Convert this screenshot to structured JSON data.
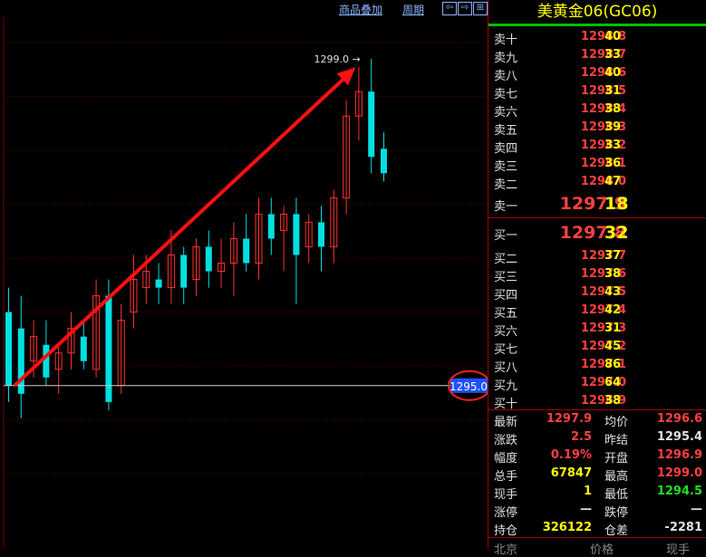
{
  "toolbar": {
    "overlay_label": "商品叠加",
    "period_label": "周期",
    "btn_prev": "⇦",
    "btn_next": "⇨",
    "btn_zoom": "⊞"
  },
  "chart_data": {
    "type": "candlestick",
    "high_annotation": "1299.0",
    "current_price_tag": "1295.0",
    "ylim": [
      1293.8,
      1299.4
    ],
    "up_color": "#ff3030",
    "down_color": "#00e0e0",
    "candles": [
      {
        "o": 1295.9,
        "h": 1296.2,
        "c": 1295.0,
        "l": 1294.8
      },
      {
        "o": 1295.7,
        "h": 1296.1,
        "c": 1294.9,
        "l": 1294.6
      },
      {
        "o": 1295.3,
        "h": 1295.8,
        "c": 1295.6,
        "l": 1295.1
      },
      {
        "o": 1295.5,
        "h": 1295.8,
        "c": 1295.1,
        "l": 1295.0
      },
      {
        "o": 1295.2,
        "h": 1295.5,
        "c": 1295.4,
        "l": 1294.9
      },
      {
        "o": 1295.4,
        "h": 1295.9,
        "c": 1295.7,
        "l": 1295.2
      },
      {
        "o": 1295.6,
        "h": 1295.8,
        "c": 1295.3,
        "l": 1295.2
      },
      {
        "o": 1295.2,
        "h": 1296.3,
        "c": 1296.1,
        "l": 1295.1
      },
      {
        "o": 1296.1,
        "h": 1296.3,
        "c": 1294.8,
        "l": 1294.7
      },
      {
        "o": 1295.0,
        "h": 1296.0,
        "c": 1295.8,
        "l": 1294.9
      },
      {
        "o": 1295.9,
        "h": 1296.6,
        "c": 1296.3,
        "l": 1295.7
      },
      {
        "o": 1296.2,
        "h": 1296.6,
        "c": 1296.4,
        "l": 1296.0
      },
      {
        "o": 1296.3,
        "h": 1296.5,
        "c": 1296.2,
        "l": 1296.0
      },
      {
        "o": 1296.2,
        "h": 1296.9,
        "c": 1296.6,
        "l": 1296.0
      },
      {
        "o": 1296.6,
        "h": 1296.7,
        "c": 1296.2,
        "l": 1296.0
      },
      {
        "o": 1296.3,
        "h": 1296.8,
        "c": 1296.7,
        "l": 1296.1
      },
      {
        "o": 1296.7,
        "h": 1296.9,
        "c": 1296.4,
        "l": 1296.2
      },
      {
        "o": 1296.4,
        "h": 1296.8,
        "c": 1296.5,
        "l": 1296.2
      },
      {
        "o": 1296.5,
        "h": 1297.0,
        "c": 1296.8,
        "l": 1296.1
      },
      {
        "o": 1296.8,
        "h": 1297.1,
        "c": 1296.5,
        "l": 1296.4
      },
      {
        "o": 1296.5,
        "h": 1297.3,
        "c": 1297.1,
        "l": 1296.3
      },
      {
        "o": 1297.1,
        "h": 1297.3,
        "c": 1296.8,
        "l": 1296.6
      },
      {
        "o": 1296.9,
        "h": 1297.2,
        "c": 1297.1,
        "l": 1296.4
      },
      {
        "o": 1297.1,
        "h": 1297.3,
        "c": 1296.6,
        "l": 1296.0
      },
      {
        "o": 1296.7,
        "h": 1297.1,
        "c": 1297.0,
        "l": 1296.5
      },
      {
        "o": 1297.0,
        "h": 1297.2,
        "c": 1296.7,
        "l": 1296.4
      },
      {
        "o": 1296.7,
        "h": 1297.4,
        "c": 1297.3,
        "l": 1296.5
      },
      {
        "o": 1297.3,
        "h": 1298.5,
        "c": 1298.3,
        "l": 1297.1
      },
      {
        "o": 1298.3,
        "h": 1298.9,
        "c": 1298.6,
        "l": 1298.0
      },
      {
        "o": 1298.6,
        "h": 1299.0,
        "c": 1297.8,
        "l": 1297.6
      },
      {
        "o": 1297.9,
        "h": 1298.1,
        "c": 1297.6,
        "l": 1297.5
      }
    ],
    "trend_arrow": {
      "from": [
        0,
        1295.0
      ],
      "to": [
        28,
        1298.9
      ]
    }
  },
  "quote": {
    "title": "美黄金06(GC06)",
    "asks": [
      {
        "label": "卖十",
        "price": "1298.8",
        "vol": "40"
      },
      {
        "label": "卖九",
        "price": "1298.7",
        "vol": "33"
      },
      {
        "label": "卖八",
        "price": "1298.6",
        "vol": "40"
      },
      {
        "label": "卖七",
        "price": "1298.5",
        "vol": "31"
      },
      {
        "label": "卖六",
        "price": "1298.4",
        "vol": "38"
      },
      {
        "label": "卖五",
        "price": "1298.3",
        "vol": "39"
      },
      {
        "label": "卖四",
        "price": "1298.2",
        "vol": "33"
      },
      {
        "label": "卖三",
        "price": "1298.1",
        "vol": "36"
      },
      {
        "label": "卖二",
        "price": "1298.0",
        "vol": "47"
      }
    ],
    "ask1": {
      "label": "卖一",
      "price": "1297.9",
      "vol": "18"
    },
    "bid1": {
      "label": "买一",
      "price": "1297.8",
      "vol": "32"
    },
    "bids": [
      {
        "label": "买二",
        "price": "1297.7",
        "vol": "37"
      },
      {
        "label": "买三",
        "price": "1297.6",
        "vol": "38"
      },
      {
        "label": "买四",
        "price": "1297.5",
        "vol": "43"
      },
      {
        "label": "买五",
        "price": "1297.4",
        "vol": "42"
      },
      {
        "label": "买六",
        "price": "1297.3",
        "vol": "31"
      },
      {
        "label": "买七",
        "price": "1297.2",
        "vol": "45"
      },
      {
        "label": "买八",
        "price": "1297.1",
        "vol": "86"
      },
      {
        "label": "买九",
        "price": "1297.0",
        "vol": "64"
      },
      {
        "label": "买十",
        "price": "1296.9",
        "vol": "38"
      }
    ],
    "stats": [
      {
        "l1": "最新",
        "v1": "1297.9",
        "c1": "#ff4040",
        "l2": "均价",
        "v2": "1296.6",
        "c2": "#ff4040"
      },
      {
        "l1": "涨跌",
        "v1": "2.5",
        "c1": "#ff4040",
        "l2": "昨结",
        "v2": "1295.4",
        "c2": "#e0e0e0"
      },
      {
        "l1": "幅度",
        "v1": "0.19%",
        "c1": "#ff4040",
        "l2": "开盘",
        "v2": "1296.9",
        "c2": "#ff4040"
      },
      {
        "l1": "总手",
        "v1": "67847",
        "c1": "#ffff00",
        "l2": "最高",
        "v2": "1299.0",
        "c2": "#ff4040"
      },
      {
        "l1": "现手",
        "v1": "1",
        "c1": "#ffff00",
        "l2": "最低",
        "v2": "1294.5",
        "c2": "#20e020"
      },
      {
        "l1": "涨停",
        "v1": "—",
        "c1": "#e0e0e0",
        "l2": "跌停",
        "v2": "—",
        "c2": "#e0e0e0"
      },
      {
        "l1": "持仓",
        "v1": "326122",
        "c1": "#ffff00",
        "l2": "仓差",
        "v2": "-2281",
        "c2": "#e0e0e0"
      }
    ],
    "footer": {
      "a": "北京",
      "b": "价格",
      "c": "现手"
    }
  }
}
